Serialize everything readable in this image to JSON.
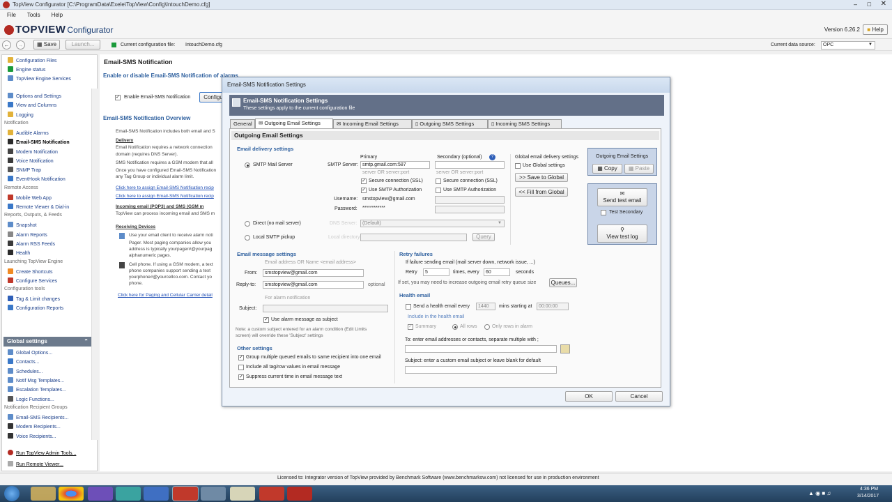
{
  "window": {
    "title": "TopView Configurator [C:\\ProgramData\\Exele\\TopView\\Config\\IntouchDemo.cfg]"
  },
  "menu": [
    "File",
    "Tools",
    "Help"
  ],
  "header": {
    "logo_main": "TOPVIEW",
    "logo_sub": "Configurator",
    "version": "Version 6.26.2",
    "help_label": "Help"
  },
  "toolbar": {
    "save_label": "Save",
    "launch_label": "Launch...",
    "config_file_label": "Current configuration file:",
    "config_file": "IntouchDemo.cfg",
    "data_source_label": "Current data source:",
    "data_source": "OPC"
  },
  "sidebar": {
    "top_items": [
      "Configuration Files",
      "Engine status",
      "TopView Engine Services"
    ],
    "items": [
      {
        "label": "Options and Settings"
      },
      {
        "label": "View and Columns"
      },
      {
        "label": "Logging"
      },
      {
        "label": "Notification",
        "header": true
      },
      {
        "label": "Audible Alarms"
      },
      {
        "label": "Email-SMS Notification",
        "selected": true
      },
      {
        "label": "Modem Notification"
      },
      {
        "label": "Voice Notification"
      },
      {
        "label": "SNMP Trap"
      },
      {
        "label": "EventHook Notification"
      },
      {
        "label": "Remote Access",
        "header": true
      },
      {
        "label": "Mobile Web App"
      },
      {
        "label": "Remote Viewer & Dial-in"
      },
      {
        "label": "Reports, Outputs, & Feeds",
        "header": true
      },
      {
        "label": "Snapshot"
      },
      {
        "label": "Alarm Reports"
      },
      {
        "label": "Alarm RSS Feeds"
      },
      {
        "label": "Health"
      },
      {
        "label": "Launching TopView Engine",
        "header": true
      },
      {
        "label": "Create Shortcuts"
      },
      {
        "label": "Configure Services"
      },
      {
        "label": "Configuration tools",
        "header": true
      },
      {
        "label": "Tag & Limit changes"
      },
      {
        "label": "Configuration Reports"
      }
    ],
    "global_label": "Global settings",
    "global_items": [
      "Global Options...",
      "Contacts...",
      "Schedules...",
      "Notif Msg Templates...",
      "Escalation Templates...",
      "Logic Functions...",
      "Notification Recipient Groups",
      "Email-SMS Recipients...",
      "Modem Recipients...",
      "Voice Recipients..."
    ],
    "bottom_items": [
      "Run TopView Admin Tools...",
      "Run Remote Viewer..."
    ]
  },
  "main": {
    "title": "Email-SMS Notification",
    "subtitle": "Enable or disable Email-SMS Notification of alarms",
    "enable_label": "Enable Email-SMS Notification",
    "configure_label": "Configu",
    "overview_title": "Email-SMS Notification Overview",
    "overview_lines": [
      {
        "text": "Email-SMS Notification includes both email and S",
        "style": "n"
      },
      {
        "text": "Delivery",
        "style": "b"
      },
      {
        "text": "Email Notification requires a network connection",
        "style": "n"
      },
      {
        "text": "domain (requires DNS Server).",
        "style": "n"
      },
      {
        "text": "SMS Notification requires a GSM modem that all",
        "style": "n"
      },
      {
        "text": "Once you have configured Email-SMS Notification",
        "style": "n"
      },
      {
        "text": "any Tag Group or individual alarm limit.",
        "style": "n"
      },
      {
        "text": "Click here to assign Email-SMS Notification recip",
        "style": "l"
      },
      {
        "text": "Click here to assign Email-SMS Notification recip",
        "style": "l"
      },
      {
        "text": "Incoming email (POP3) and SMS (GSM m",
        "style": "b"
      },
      {
        "text": "TopView can process incoming email and SMS m",
        "style": "n"
      },
      {
        "text": "Receiving Devices",
        "style": "b"
      },
      {
        "text": "Use your email client to receive alarm noti",
        "style": "n"
      },
      {
        "text": "Pager. Most paging companies allow you",
        "style": "n"
      },
      {
        "text": "address is typically yourpager#@yourpag",
        "style": "n"
      },
      {
        "text": "alphanumeric pages.",
        "style": "n"
      },
      {
        "text": "Cell phone. If using a GSM modem, a text",
        "style": "n"
      },
      {
        "text": "phone companies support sending a text",
        "style": "n"
      },
      {
        "text": "yourphone#@yourcellco.com. Contact yo",
        "style": "n"
      },
      {
        "text": "phone.",
        "style": "n"
      },
      {
        "text": "Click here for Paging and Cellular Carrier detail",
        "style": "l"
      }
    ]
  },
  "dialog": {
    "title": "Email-SMS Notification Settings",
    "banner_title": "Email-SMS Notification  Settings",
    "banner_sub": "These settings apply to the current configuration file",
    "tabs": [
      "General",
      "Outgoing Email Settings",
      "Incoming Email Settings",
      "Outgoing SMS Settings",
      "Incoming SMS Settings"
    ],
    "section": "Outgoing Email Settings",
    "delivery": {
      "title": "Email delivery settings",
      "smtp_mail_server": "SMTP Mail Server",
      "primary": "Primary",
      "secondary": "Secondary (optional)",
      "smtp_server_label": "SMTP Server:",
      "smtp_server": "smtp.gmail.com:587",
      "hint": "server OR server:port",
      "secure_ssl": "Secure connection (SSL)",
      "smtp_auth": "Use SMTP Authorization",
      "username_label": "Username:",
      "username": "smstopview@gmail.com",
      "password_label": "Password:",
      "password": "************",
      "direct": "Direct (no mail server)",
      "dns_label": "DNS Server:",
      "dns_value": "(Default)",
      "local_smtp": "Local SMTP pickup",
      "local_dir_label": "Local directory:",
      "query_label": "Query",
      "global_title": "Global email delivery settings",
      "use_global": "Use Global settings",
      "save_global": ">> Save to Global",
      "fill_global": "<< Fill from Global"
    },
    "side": {
      "title": "Outgoing Email Settings",
      "copy": "Copy",
      "paste": "Paste",
      "send_test": "Send test email",
      "test_secondary": "Test Secondary",
      "view_log": "View test log"
    },
    "message": {
      "title": "Email message settings",
      "addr_hint": "Email address OR Name <email address>",
      "from_label": "From:",
      "from": "smstopview@gmail.com",
      "reply_label": "Reply-to:",
      "reply": "smstopview@gmail.com",
      "optional": "optional",
      "for_alarm": "For alarm notification",
      "subject_label": "Subject:",
      "use_alarm": "Use alarm message as subject",
      "note1": "Note: a custom subject entered for an alarm condition (Edit Limits",
      "note2": "screen) will override these 'Subject' settings"
    },
    "other": {
      "title": "Other settings",
      "opt1": "Group multiple queued emails to same recipient into one email",
      "opt2": "Include all tag/row values in email message",
      "opt3": "Suppress current time in email message text"
    },
    "retry": {
      "title": "Retry failures",
      "line1": "If failure sending email (mail server down, network issue, ...)",
      "retry_label": "Retry",
      "retry_value": "5",
      "times_label": "times, every",
      "every_value": "60",
      "seconds": "seconds",
      "queue_note": "If set, you may need to increase outgoing email retry queue size",
      "queues": "Queues..."
    },
    "health": {
      "title": "Health email",
      "send_label": "Send a health email  every",
      "every_value": "1440",
      "mins_label": "mins starting at",
      "start_value": "00:00:00",
      "include_label": "Include in the health email",
      "summary": "Summary",
      "all_rows": "All rows",
      "only_rows": "Only rows in alarm",
      "to_label": "To: enter email addresses or contacts, separate multiple with ;",
      "subject_label": "Subject: enter a custom email subject or leave blank for default"
    },
    "ok": "OK",
    "cancel": "Cancel"
  },
  "status": {
    "license": "Licensed to: Integrator version of TopView provided by Benchmark Software (www.benchmarksw.com) not licensed for use in production environment"
  },
  "taskbar": {
    "time": "4:36 PM",
    "date": "3/14/2017"
  }
}
